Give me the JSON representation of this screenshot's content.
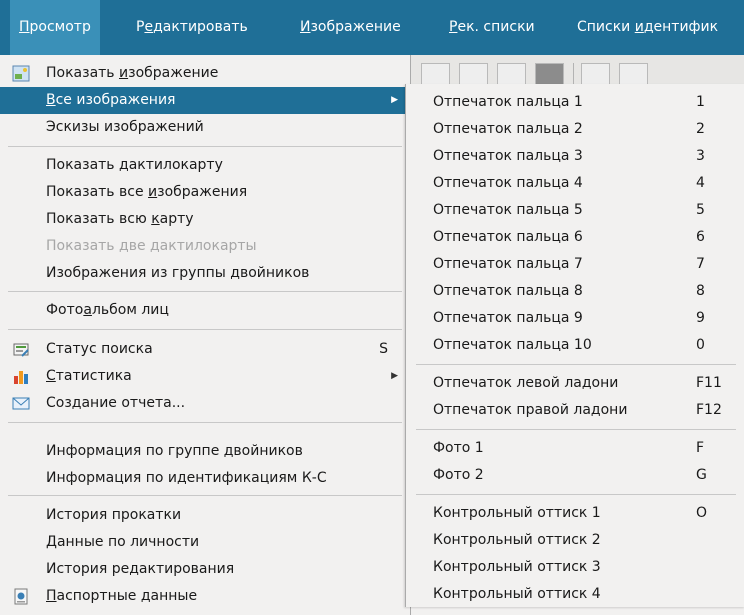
{
  "menubar": {
    "items": [
      {
        "pre": "",
        "acc": "П",
        "post": "росмотр"
      },
      {
        "pre": "Р",
        "acc": "е",
        "post": "дактировать"
      },
      {
        "pre": "",
        "acc": "И",
        "post": "зображение"
      },
      {
        "pre": "",
        "acc": "Р",
        "post": "ек. списки"
      },
      {
        "pre": "Списки ",
        "acc": "и",
        "post": "дентифик"
      }
    ]
  },
  "view_menu": {
    "show_image": {
      "pre": "Показать ",
      "acc": "и",
      "post": "зображение"
    },
    "all_images": {
      "pre": "",
      "acc": "В",
      "post": "се изображения"
    },
    "thumbnails": "Эскизы изображений",
    "show_card": {
      "pre": "Показать ",
      "acc": "д",
      "post": "актилокарту"
    },
    "show_all_images": {
      "pre": "Показать все ",
      "acc": "и",
      "post": "зображения"
    },
    "show_full_card": {
      "pre": "Показать всю ",
      "acc": "к",
      "post": "арту"
    },
    "show_two_cards": "Показать две дактилокарты",
    "twin_group_images": "Изображения из группы двойников",
    "face_album": {
      "pre": "Фото",
      "acc": "а",
      "post": "льбом лиц"
    },
    "search_status": "Статус поиска",
    "search_status_shortcut": "S",
    "statistics": {
      "pre": "",
      "acc": "С",
      "post": "татистика"
    },
    "create_report": "Создание отчета...",
    "twin_group_info": "Информация по группе двойников",
    "kc_info": "Информация по идентификациям К-С",
    "rolling_history": "История прокатки",
    "person_data": "Данные по личности",
    "edit_history": "История редактирования",
    "passport_data": {
      "pre": "",
      "acc": "П",
      "post": "аспортные данные"
    }
  },
  "submenu": {
    "fingers": [
      {
        "label": "Отпечаток пальца 1",
        "shortcut": "1"
      },
      {
        "label": "Отпечаток пальца 2",
        "shortcut": "2"
      },
      {
        "label": "Отпечаток пальца 3",
        "shortcut": "3"
      },
      {
        "label": "Отпечаток пальца 4",
        "shortcut": "4"
      },
      {
        "label": "Отпечаток пальца 5",
        "shortcut": "5"
      },
      {
        "label": "Отпечаток пальца 6",
        "shortcut": "6"
      },
      {
        "label": "Отпечаток пальца 7",
        "shortcut": "7"
      },
      {
        "label": "Отпечаток пальца 8",
        "shortcut": "8"
      },
      {
        "label": "Отпечаток пальца 9",
        "shortcut": "9"
      },
      {
        "label": "Отпечаток пальца 10",
        "shortcut": "0"
      }
    ],
    "palms": [
      {
        "label": "Отпечаток левой ладони",
        "shortcut": "F11"
      },
      {
        "label": "Отпечаток правой ладони",
        "shortcut": "F12"
      }
    ],
    "photos": [
      {
        "label": "Фото 1",
        "shortcut": "F"
      },
      {
        "label": "Фото 2",
        "shortcut": "G"
      }
    ],
    "controls": [
      {
        "label": "Контрольный оттиск 1",
        "shortcut": "O"
      },
      {
        "label": "Контрольный оттиск 2",
        "shortcut": ""
      },
      {
        "label": "Контрольный оттиск 3",
        "shortcut": ""
      },
      {
        "label": "Контрольный оттиск 4",
        "shortcut": ""
      }
    ]
  },
  "icons": {
    "show_image": "image-icon",
    "search_status": "search-status-icon",
    "statistics": "bar-chart-icon",
    "create_report": "envelope-icon",
    "passport_data": "passport-icon",
    "submenu_arrow": "triangle-right-icon"
  },
  "colors": {
    "menubar_bg": "#1f6f97",
    "highlight": "#1f6f97",
    "menu_bg": "#f2f1f0",
    "disabled_text": "#a6a6a6"
  }
}
